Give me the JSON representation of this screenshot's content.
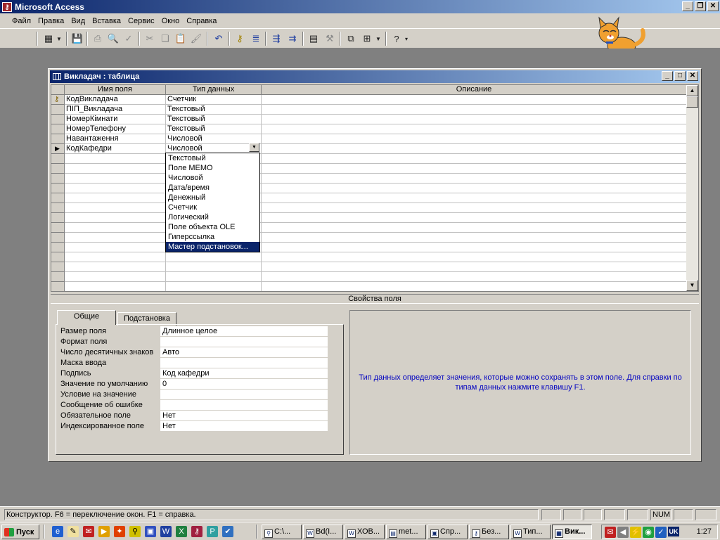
{
  "app": {
    "title": "Microsoft Access",
    "icon": "access-key-icon"
  },
  "menu": [
    {
      "label": "Файл",
      "id": "file"
    },
    {
      "label": "Правка",
      "id": "edit"
    },
    {
      "label": "Вид",
      "id": "view"
    },
    {
      "label": "Вставка",
      "id": "insert"
    },
    {
      "label": "Сервис",
      "id": "tools"
    },
    {
      "label": "Окно",
      "id": "window"
    },
    {
      "label": "Справка",
      "id": "help"
    }
  ],
  "child_window": {
    "title": "Викладач : таблица"
  },
  "grid": {
    "headers": {
      "field_name": "Имя поля",
      "data_type": "Тип данных",
      "description": "Описание"
    },
    "rows": [
      {
        "name": "КодВикладача",
        "type": "Счетчик"
      },
      {
        "name": "ПІП_Викладача",
        "type": "Текстовый"
      },
      {
        "name": "НомерКімнати",
        "type": "Текстовый"
      },
      {
        "name": "НомерТелефону",
        "type": "Текстовый"
      },
      {
        "name": "Навантаження",
        "type": "Числовой"
      },
      {
        "name": "КодКафедри",
        "type": "Числовой"
      }
    ]
  },
  "dropdown": {
    "items": [
      "Текстовый",
      "Поле МЕМО",
      "Числовой",
      "Дата/время",
      "Денежный",
      "Счетчик",
      "Логический",
      "Поле объекта OLE",
      "Гиперссылка",
      "Мастер подстановок..."
    ],
    "selected_index": 9
  },
  "properties_caption": "Свойства поля",
  "tabs": {
    "general": "Общие",
    "lookup": "Подстановка"
  },
  "properties": [
    {
      "label": "Размер поля",
      "value": "Длинное целое"
    },
    {
      "label": "Формат поля",
      "value": ""
    },
    {
      "label": "Число десятичных знаков",
      "value": "Авто"
    },
    {
      "label": "Маска ввода",
      "value": ""
    },
    {
      "label": "Подпись",
      "value": "Код кафедри"
    },
    {
      "label": "Значение по умолчанию",
      "value": "0"
    },
    {
      "label": "Условие на значение",
      "value": ""
    },
    {
      "label": "Сообщение об ошибке",
      "value": ""
    },
    {
      "label": "Обязательное поле",
      "value": "Нет"
    },
    {
      "label": "Индексированное поле",
      "value": "Нет"
    }
  ],
  "help_text": "Тип данных определяет значения, которые можно сохранять в этом поле.  Для справки по типам данных нажмите клавишу F1.",
  "status": {
    "text": "Конструктор.  F6 = переключение окон.  F1 = справка.",
    "num": "NUM"
  },
  "taskbar": {
    "start": "Пуск",
    "tasks": [
      "C:\\...",
      "Bd(I...",
      "ХОВ...",
      "met...",
      "Спр...",
      "Без...",
      "Тип...",
      "Вик..."
    ],
    "active_index": 7,
    "tray_lang": "UK",
    "clock": "1:27"
  },
  "colors": {
    "title_start": "#0a246a",
    "title_end": "#a6caf0",
    "face": "#d4d0c8",
    "help_text": "#0000c0"
  }
}
